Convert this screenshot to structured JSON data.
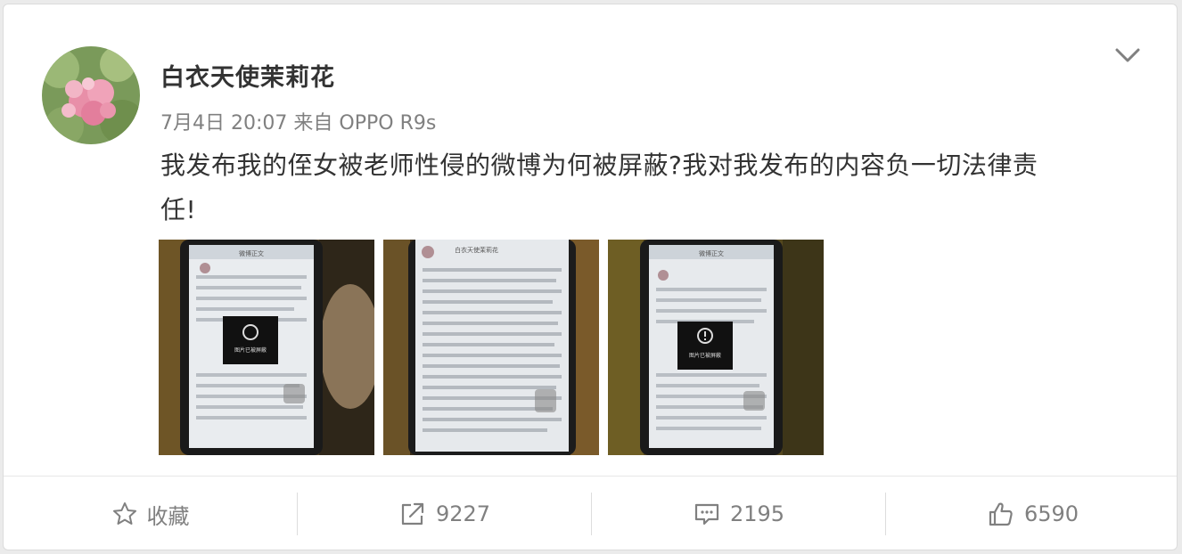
{
  "post": {
    "username": "白衣天使茉莉花",
    "date": "7月4日 20:07",
    "from_label": "来自",
    "device": "OPPO R9s",
    "text_line1": "我发布我的侄女被老师性侵的微博为何被屏蔽?我对我发布的内容负一切法律责",
    "text_line2": "任!",
    "images": [
      {
        "caption": "微博正文",
        "overlay": "图片已被屏蔽"
      },
      {
        "caption": "白衣天使茉莉花",
        "overlay": ""
      },
      {
        "caption": "微博正文",
        "overlay": "图片已被屏蔽"
      }
    ]
  },
  "actions": {
    "favorite_label": "收藏",
    "repost_count": "9227",
    "comment_count": "2195",
    "like_count": "6590"
  },
  "icons": {
    "favorite": "star-outline-icon",
    "repost": "share-arrow-icon",
    "comment": "comment-bubble-icon",
    "like": "thumbs-up-icon",
    "menu": "chevron-down-icon"
  },
  "colors": {
    "text_primary": "#333333",
    "text_secondary": "#808080",
    "divider": "#e6e6e6"
  }
}
